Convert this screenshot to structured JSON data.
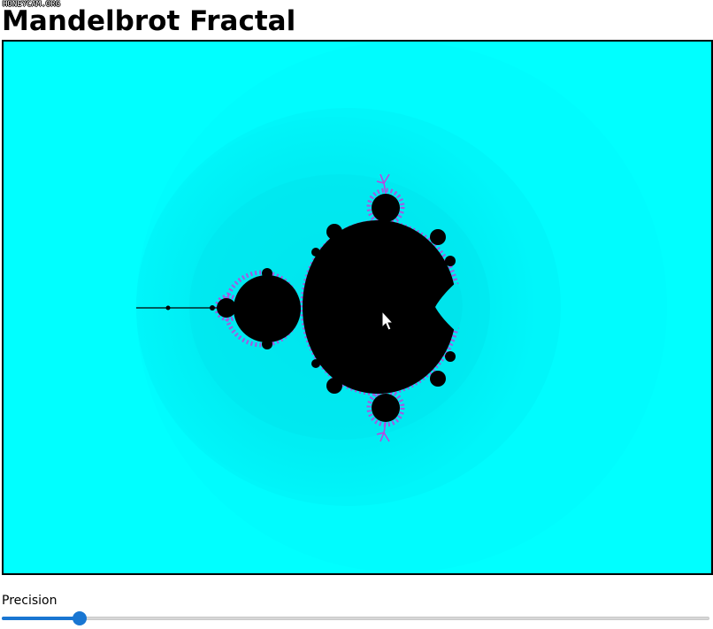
{
  "watermark": "HONEYCAM.ORG",
  "page": {
    "title": "Mandelbrot Fractal"
  },
  "fractal": {
    "background_color": "#00ffff",
    "set_color": "#000000",
    "edge_color": "#c040e0",
    "cursor": "arrow-cursor-icon"
  },
  "controls": {
    "precision_label": "Precision",
    "precision_fraction": 0.11,
    "accent_color": "#1976d2"
  }
}
